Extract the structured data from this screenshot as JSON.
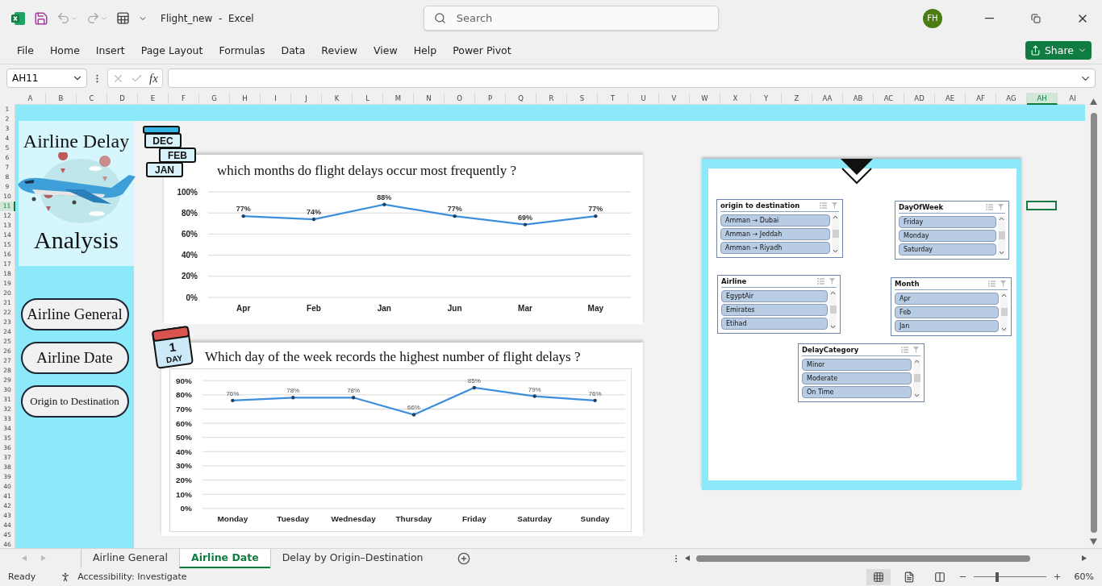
{
  "window": {
    "title": "Flight_new  -  Excel",
    "user_initials": "FH",
    "search": {
      "placeholder": "Search"
    }
  },
  "ribbon_tabs": [
    "File",
    "Home",
    "Insert",
    "Page Layout",
    "Formulas",
    "Data",
    "Review",
    "View",
    "Help",
    "Power Pivot"
  ],
  "share_button": "Share",
  "formula_bar": {
    "name_box": "AH11",
    "fx": "fx"
  },
  "column_headers": [
    {
      "label": "A",
      "selected": false
    },
    {
      "label": "B",
      "selected": false
    },
    {
      "label": "C",
      "selected": false
    },
    {
      "label": "D",
      "selected": false
    },
    {
      "label": "E",
      "selected": false
    },
    {
      "label": "F",
      "selected": false
    },
    {
      "label": "G",
      "selected": false
    },
    {
      "label": "H",
      "selected": false
    },
    {
      "label": "I",
      "selected": false
    },
    {
      "label": "J",
      "selected": false
    },
    {
      "label": "K",
      "selected": false
    },
    {
      "label": "L",
      "selected": false
    },
    {
      "label": "M",
      "selected": false
    },
    {
      "label": "N",
      "selected": false
    },
    {
      "label": "O",
      "selected": false
    },
    {
      "label": "P",
      "selected": false
    },
    {
      "label": "Q",
      "selected": false
    },
    {
      "label": "R",
      "selected": false
    },
    {
      "label": "S",
      "selected": false
    },
    {
      "label": "T",
      "selected": false
    },
    {
      "label": "U",
      "selected": false
    },
    {
      "label": "V",
      "selected": false
    },
    {
      "label": "W",
      "selected": false
    },
    {
      "label": "X",
      "selected": false
    },
    {
      "label": "Y",
      "selected": false
    },
    {
      "label": "Z",
      "selected": false
    },
    {
      "label": "AA",
      "selected": false
    },
    {
      "label": "AB",
      "selected": false
    },
    {
      "label": "AC",
      "selected": false
    },
    {
      "label": "AD",
      "selected": false
    },
    {
      "label": "AE",
      "selected": false
    },
    {
      "label": "AF",
      "selected": false
    },
    {
      "label": "AG",
      "selected": false
    },
    {
      "label": "AH",
      "selected": true
    },
    {
      "label": "AI",
      "selected": false
    }
  ],
  "row_headers": [
    {
      "label": "1",
      "selected": false
    },
    {
      "label": "2",
      "selected": false
    },
    {
      "label": "3",
      "selected": false
    },
    {
      "label": "4",
      "selected": false
    },
    {
      "label": "5",
      "selected": false
    },
    {
      "label": "6",
      "selected": false
    },
    {
      "label": "7",
      "selected": false
    },
    {
      "label": "8",
      "selected": false
    },
    {
      "label": "9",
      "selected": false
    },
    {
      "label": "10",
      "selected": false
    },
    {
      "label": "11",
      "selected": true
    },
    {
      "label": "12",
      "selected": false
    },
    {
      "label": "13",
      "selected": false
    },
    {
      "label": "14",
      "selected": false
    },
    {
      "label": "15",
      "selected": false
    },
    {
      "label": "16",
      "selected": false
    },
    {
      "label": "17",
      "selected": false
    },
    {
      "label": "18",
      "selected": false
    },
    {
      "label": "19",
      "selected": false
    },
    {
      "label": "20",
      "selected": false
    },
    {
      "label": "21",
      "selected": false
    },
    {
      "label": "22",
      "selected": false
    },
    {
      "label": "23",
      "selected": false
    },
    {
      "label": "24",
      "selected": false
    },
    {
      "label": "25",
      "selected": false
    },
    {
      "label": "26",
      "selected": false
    },
    {
      "label": "27",
      "selected": false
    },
    {
      "label": "28",
      "selected": false
    },
    {
      "label": "29",
      "selected": false
    },
    {
      "label": "30",
      "selected": false
    },
    {
      "label": "31",
      "selected": false
    },
    {
      "label": "32",
      "selected": false
    },
    {
      "label": "33",
      "selected": false
    },
    {
      "label": "34",
      "selected": false
    },
    {
      "label": "35",
      "selected": false
    },
    {
      "label": "36",
      "selected": false
    },
    {
      "label": "37",
      "selected": false
    },
    {
      "label": "38",
      "selected": false
    },
    {
      "label": "39",
      "selected": false
    },
    {
      "label": "40",
      "selected": false
    },
    {
      "label": "41",
      "selected": false
    },
    {
      "label": "42",
      "selected": false
    },
    {
      "label": "43",
      "selected": false
    },
    {
      "label": "44",
      "selected": false
    },
    {
      "label": "45",
      "selected": false
    },
    {
      "label": "46",
      "selected": false
    }
  ],
  "sidebar": {
    "title": "Airline Delay",
    "subtitle": "Analysis",
    "buttons": [
      "Airline General",
      "Airline Date",
      "Origin to Destination"
    ]
  },
  "month_chart": {
    "icon_labels": [
      "DEC",
      "FEB",
      "JAN"
    ],
    "title": "which months do flight delays occur most frequently ?",
    "chart_data": {
      "type": "line",
      "categories": [
        "Apr",
        "Feb",
        "Jan",
        "Jun",
        "Mar",
        "May"
      ],
      "series": [
        {
          "color": "#3d8fdc",
          "values": [
            0.77,
            0.74,
            0.88,
            0.77,
            0.69,
            0.77
          ]
        }
      ],
      "ylim": [
        0,
        1
      ],
      "yticks": [
        {
          "value": 0,
          "label": "0%"
        },
        {
          "value": 0.2,
          "label": "20%"
        },
        {
          "value": 0.4,
          "label": "40%"
        },
        {
          "value": 0.6,
          "label": "60%"
        },
        {
          "value": 0.8,
          "label": "80%"
        },
        {
          "value": 1,
          "label": "100%"
        }
      ],
      "grid": true,
      "value_labels": [
        "77%",
        "74%",
        "88%",
        "77%",
        "69%",
        "77%"
      ]
    }
  },
  "day_chart": {
    "icon_number": "1",
    "icon_label": "DAY",
    "title": "Which day of the week records the highest number of flight delays ?",
    "chart_data": {
      "type": "line",
      "categories": [
        "Monday",
        "Tuesday",
        "Wednesday",
        "Thursday",
        "Friday",
        "Saturday",
        "Sunday"
      ],
      "series": [
        {
          "color": "#3d8fdc",
          "values": [
            0.76,
            0.78,
            0.78,
            0.66,
            0.85,
            0.79,
            0.76
          ]
        }
      ],
      "ylim": [
        0,
        0.9
      ],
      "yticks": [
        {
          "value": 0,
          "label": "0%"
        },
        {
          "value": 0.1,
          "label": "10%"
        },
        {
          "value": 0.2,
          "label": "20%"
        },
        {
          "value": 0.3,
          "label": "30%"
        },
        {
          "value": 0.4,
          "label": "40%"
        },
        {
          "value": 0.5,
          "label": "50%"
        },
        {
          "value": 0.6,
          "label": "60%"
        },
        {
          "value": 0.7,
          "label": "70%"
        },
        {
          "value": 0.8,
          "label": "80%"
        },
        {
          "value": 0.9,
          "label": "90%"
        }
      ],
      "grid": true,
      "value_labels": [
        "76%",
        "78%",
        "78%",
        "66%",
        "85%",
        "79%",
        "76%"
      ]
    }
  },
  "slicers": [
    {
      "title": "origin to destination",
      "items": [
        {
          "label": "Amman → Dubai",
          "selected": true
        },
        {
          "label": "Amman → Jeddah",
          "selected": true
        },
        {
          "label": "Amman → Riyadh",
          "selected": true
        }
      ]
    },
    {
      "title": "DayOfWeek",
      "items": [
        {
          "label": "Friday",
          "selected": true
        },
        {
          "label": "Monday",
          "selected": true
        },
        {
          "label": "Saturday",
          "selected": true
        }
      ]
    },
    {
      "title": "Airline",
      "items": [
        {
          "label": "EgyptAir",
          "selected": true
        },
        {
          "label": "Emirates",
          "selected": true
        },
        {
          "label": "Etihad",
          "selected": true
        }
      ]
    },
    {
      "title": "Month",
      "items": [
        {
          "label": "Apr",
          "selected": true
        },
        {
          "label": "Feb",
          "selected": true
        },
        {
          "label": "Jan",
          "selected": true
        }
      ]
    },
    {
      "title": "DelayCategory",
      "items": [
        {
          "label": "Minor",
          "selected": true
        },
        {
          "label": "Moderate",
          "selected": true
        },
        {
          "label": "On Time",
          "selected": true
        }
      ]
    }
  ],
  "sheet_tabs": [
    {
      "label": "Airline General",
      "selected": false
    },
    {
      "label": "Airline Date",
      "selected": true
    },
    {
      "label": "Delay by Origin–Destination",
      "selected": false
    }
  ],
  "status_bar": {
    "status": "Ready",
    "accessibility": "Accessibility: Investigate",
    "zoom": {
      "level": 0.33,
      "reading": "60%"
    }
  }
}
